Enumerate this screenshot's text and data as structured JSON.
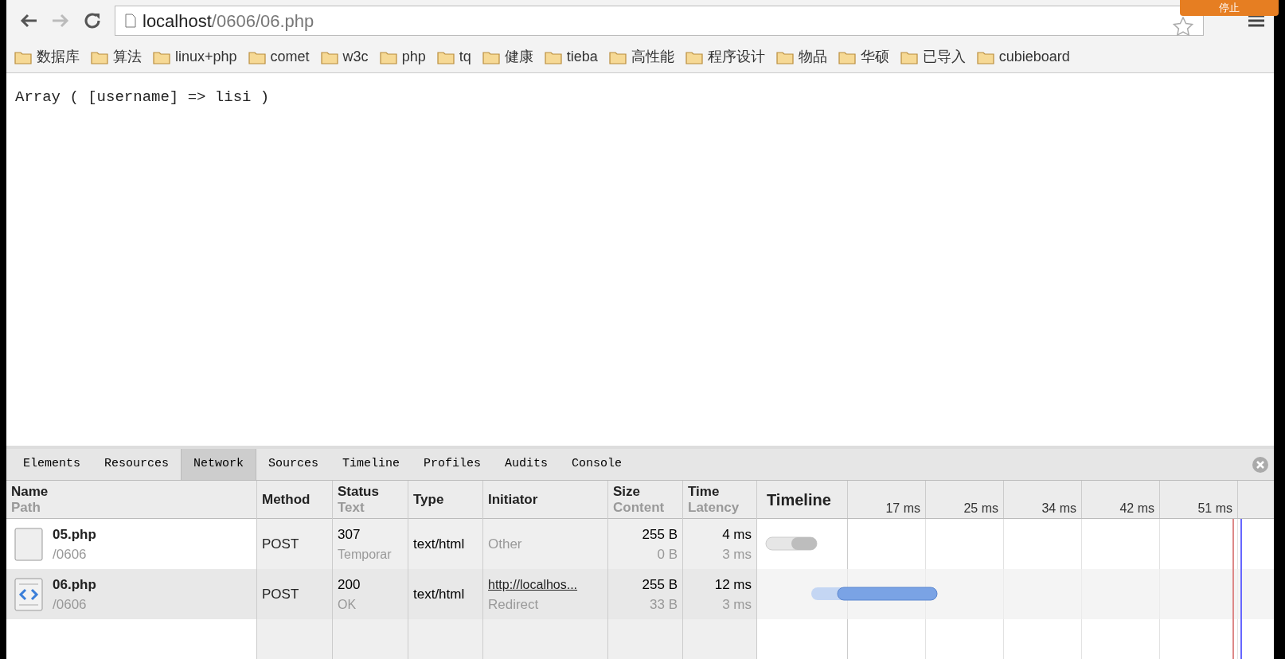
{
  "toolbar": {
    "url_host": "localhost",
    "url_path": "/0606/06.php",
    "stop_button": "停止"
  },
  "bookmarks": [
    "数据库",
    "算法",
    "linux+php",
    "comet",
    "w3c",
    "php",
    "tq",
    "健康",
    "tieba",
    "高性能",
    "程序设计",
    "物品",
    "华硕",
    "已导入",
    "cubieboard"
  ],
  "page_text": "Array ( [username] => lisi )",
  "devtools": {
    "tabs": [
      {
        "label": "Elements",
        "selected": false
      },
      {
        "label": "Resources",
        "selected": false
      },
      {
        "label": "Network",
        "selected": true
      },
      {
        "label": "Sources",
        "selected": false
      },
      {
        "label": "Timeline",
        "selected": false
      },
      {
        "label": "Profiles",
        "selected": false
      },
      {
        "label": "Audits",
        "selected": false
      },
      {
        "label": "Console",
        "selected": false
      }
    ],
    "columns": [
      {
        "title": "Name",
        "subtitle": "Path"
      },
      {
        "title": "Method"
      },
      {
        "title": "Status",
        "subtitle": "Text"
      },
      {
        "title": "Type"
      },
      {
        "title": "Initiator"
      },
      {
        "title": "Size",
        "subtitle": "Content"
      },
      {
        "title": "Time",
        "subtitle": "Latency"
      },
      {
        "title": "Timeline"
      }
    ],
    "ticks": [
      "17 ms",
      "25 ms",
      "34 ms",
      "42 ms",
      "51 ms"
    ],
    "rows": [
      {
        "kind": "blank",
        "name": "05.php",
        "path": "/0606",
        "method": "POST",
        "status": "307",
        "status_text": "Temporar",
        "type": "text/html",
        "initiator": "Other",
        "initiator_link": false,
        "size": "255 B",
        "content": "0 B",
        "time": "4 ms",
        "latency": "3 ms"
      },
      {
        "kind": "document",
        "name": "06.php",
        "path": "/0606",
        "method": "POST",
        "status": "200",
        "status_text": "OK",
        "type": "text/html",
        "initiator": "http://localhos...",
        "initiator_sub": "Redirect",
        "initiator_link": true,
        "size": "255 B",
        "content": "33 B",
        "time": "12 ms",
        "latency": "3 ms"
      }
    ]
  }
}
